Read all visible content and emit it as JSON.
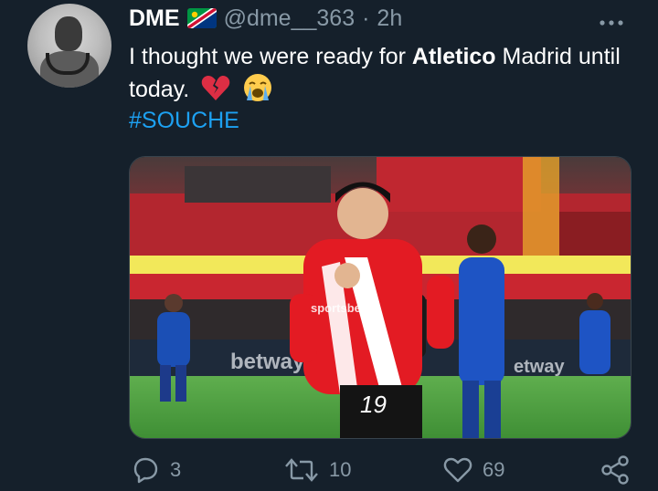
{
  "user": {
    "name": "DME",
    "handle": "@dme__363",
    "separator": "·",
    "time": "2h",
    "flag_icon": "namibia-flag-icon",
    "avatar_icon": "avatar"
  },
  "tweet": {
    "text_before": "I thought we were ready for ",
    "text_bold": "Atletico",
    "text_after": " Madrid until today.",
    "emojis": [
      "broken-heart-icon",
      "loudly-crying-face-icon"
    ],
    "hashtag": "#SOUCHE"
  },
  "media": {
    "description_icon": "football-photo",
    "jersey_number": "19",
    "sponsor_text": "sportsbet.io",
    "ad_board_text": "betway"
  },
  "actions": {
    "reply_count": "3",
    "retweet_count": "10",
    "like_count": "69"
  },
  "colors": {
    "background": "#15202b",
    "accent": "#1da1f2",
    "muted": "#8899a6"
  }
}
